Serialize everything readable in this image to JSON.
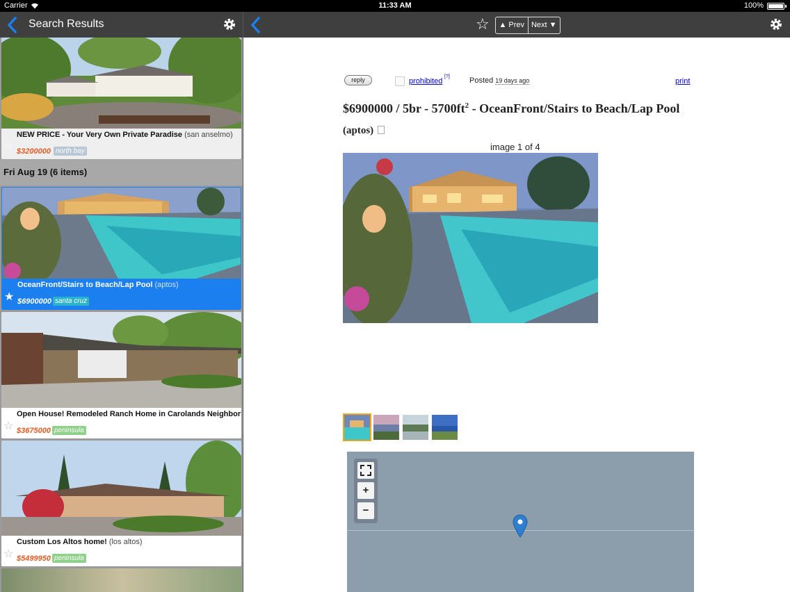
{
  "status_bar": {
    "carrier": "Carrier",
    "time": "11:33 AM",
    "battery": "100%"
  },
  "left_nav": {
    "title": "Search Results"
  },
  "listings_top": [
    {
      "title": "NEW PRICE - Your Very Own Private Paradise",
      "location": "(san anselmo)",
      "price": "$3200000",
      "area": "north bay",
      "area_color": "#b8c6d6"
    }
  ],
  "day_header": "Fri Aug 19 (6 items)",
  "listings": [
    {
      "title": "OceanFront/Stairs to Beach/Lap Pool",
      "location": "(aptos)",
      "price": "$6900000",
      "area": "santa cruz",
      "area_color": "#2db3c9",
      "selected": true
    },
    {
      "title": "Open House! Remodeled Ranch Home in Carolands Neighborhood!",
      "location": "",
      "price": "$3675000",
      "area": "peninsula",
      "area_color": "#8fd18a",
      "selected": false
    },
    {
      "title": "Custom Los Altos home!",
      "location": "(los altos)",
      "price": "$5499950",
      "area": "peninsula",
      "area_color": "#8fd18a",
      "selected": false
    }
  ],
  "right_nav": {
    "prev_label": "▲ Prev",
    "next_label": "Next ▼"
  },
  "post": {
    "reply_label": "reply",
    "prohibited_label": "prohibited",
    "prohibited_sup": "[?]",
    "posted_label": "Posted",
    "posted_ago": "19 days ago",
    "print_label": "print",
    "headline": "$6900000 / 5br - 5700ft",
    "headline_sup": "2",
    "headline_rest": " - OceanFront/Stairs to Beach/Lap Pool",
    "headline_location": "(aptos)",
    "image_counter": "image 1 of 4"
  },
  "map": {
    "fullscreen_icon": "fullscreen-icon",
    "zoom_in": "+",
    "zoom_out": "−"
  },
  "colors": {
    "accent": "#1b7ff0",
    "navbar": "#3f3f3f",
    "price": "#e25b24",
    "map": "#8c9dab"
  }
}
